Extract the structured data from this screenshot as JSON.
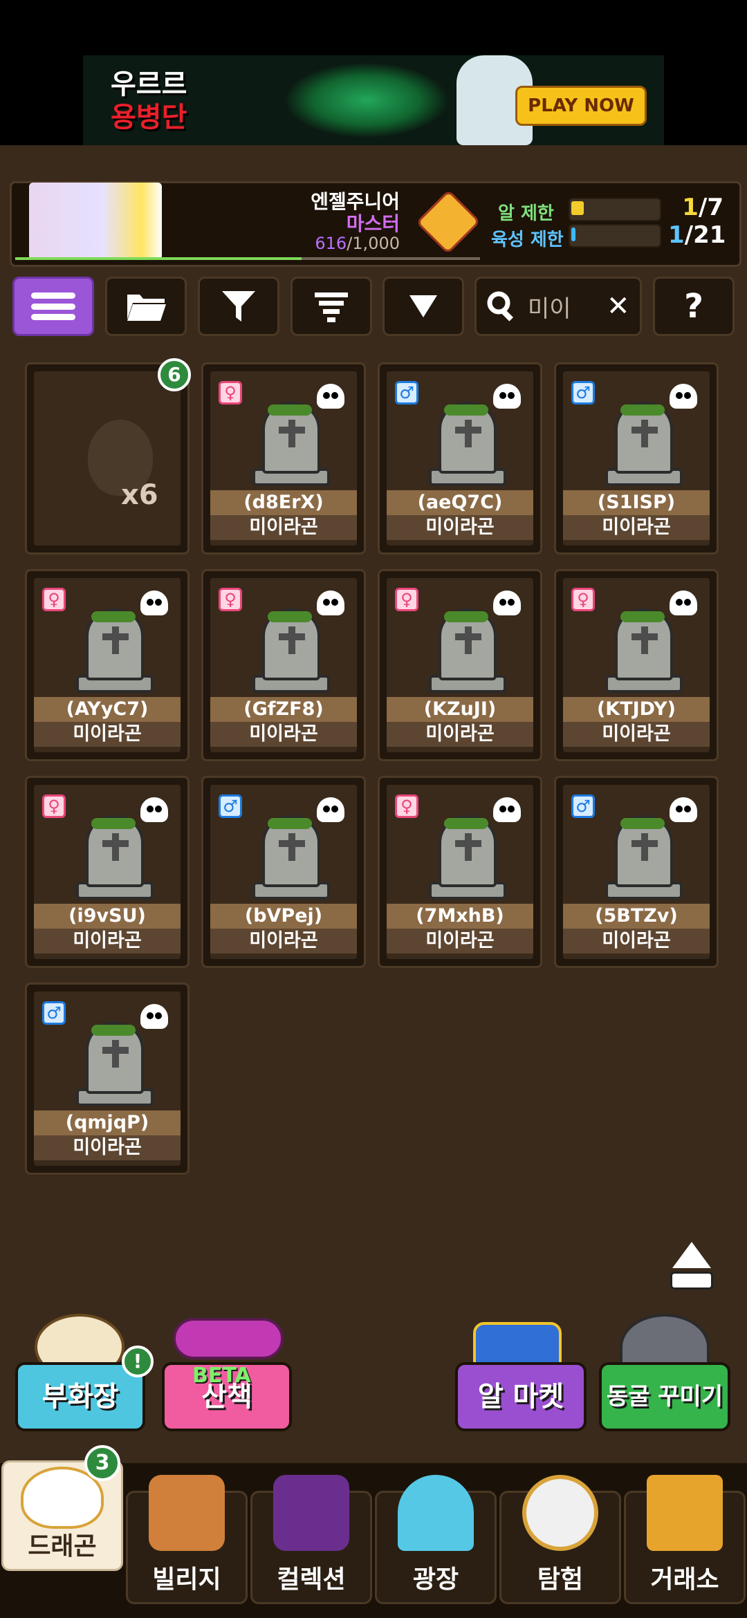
{
  "ad": {
    "title_line1": "우르르",
    "title_line2": "용병단",
    "cta": "PLAY NOW"
  },
  "profile": {
    "title_line1": "엔젤주니어",
    "title_line2": "마스터",
    "xp_current": "616",
    "xp_max": "/1,000",
    "xp_fraction": 0.616,
    "egg_limit_label": "알 제한",
    "egg_limit_current": "1",
    "egg_limit_max": "/7",
    "raise_limit_label": "육성 제한",
    "raise_limit_current": "1",
    "raise_limit_max": "/21"
  },
  "toolbar": {
    "search_value": "미이",
    "help_label": "?"
  },
  "egg_slot": {
    "badge": "6",
    "count": "x6"
  },
  "cards": [
    {
      "gender": "female",
      "gender_symbol": "♀",
      "code": "(d8ErX)",
      "species": "미이라곤"
    },
    {
      "gender": "male",
      "gender_symbol": "♂",
      "code": "(aeQ7C)",
      "species": "미이라곤"
    },
    {
      "gender": "male",
      "gender_symbol": "♂",
      "code": "(S1ISP)",
      "species": "미이라곤"
    },
    {
      "gender": "female",
      "gender_symbol": "♀",
      "code": "(AYyC7)",
      "species": "미이라곤"
    },
    {
      "gender": "female",
      "gender_symbol": "♀",
      "code": "(GfZF8)",
      "species": "미이라곤"
    },
    {
      "gender": "female",
      "gender_symbol": "♀",
      "code": "(KZuJI)",
      "species": "미이라곤"
    },
    {
      "gender": "female",
      "gender_symbol": "♀",
      "code": "(KTJDY)",
      "species": "미이라곤"
    },
    {
      "gender": "female",
      "gender_symbol": "♀",
      "code": "(i9vSU)",
      "species": "미이라곤"
    },
    {
      "gender": "male",
      "gender_symbol": "♂",
      "code": "(bVPej)",
      "species": "미이라곤"
    },
    {
      "gender": "female",
      "gender_symbol": "♀",
      "code": "(7MxhB)",
      "species": "미이라곤"
    },
    {
      "gender": "male",
      "gender_symbol": "♂",
      "code": "(5BTZv)",
      "species": "미이라곤"
    },
    {
      "gender": "male",
      "gender_symbol": "♂",
      "code": "(qmjqP)",
      "species": "미이라곤"
    }
  ],
  "quick": {
    "hatchery": "부화장",
    "hatchery_alert": "!",
    "walk_beta": "BETA",
    "walk": "산책",
    "egg_market": "알 마켓",
    "cave_decor": "동굴 꾸미기"
  },
  "nav": {
    "dragon": "드래곤",
    "dragon_badge": "3",
    "village": "빌리지",
    "collection": "컬렉션",
    "square": "광장",
    "explore": "탐험",
    "trade": "거래소"
  },
  "colors": {
    "background": "#3a2a1b",
    "female": "#e8467a",
    "male": "#1c7be0",
    "menu_active": "#9b56d8"
  }
}
